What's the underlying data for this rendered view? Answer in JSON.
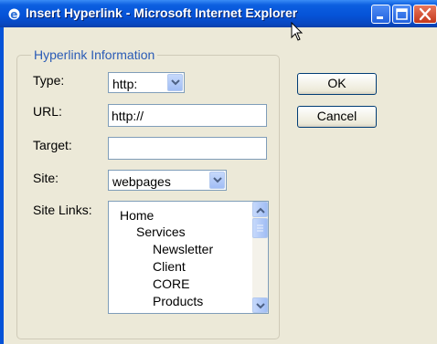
{
  "window": {
    "title": "Insert Hyperlink - Microsoft Internet Explorer",
    "icons": [
      "ie-icon",
      "minimize-icon",
      "maximize-icon",
      "close-icon"
    ]
  },
  "form": {
    "group_title": "Hyperlink Information",
    "type": {
      "label": "Type:",
      "value": "http:"
    },
    "url": {
      "label": "URL:",
      "value": "http://"
    },
    "target": {
      "label": "Target:",
      "value": ""
    },
    "site": {
      "label": "Site:",
      "value": "webpages"
    },
    "site_links": {
      "label": "Site Links:",
      "items": [
        "Home",
        "Services",
        "Newsletter",
        "Client",
        "CORE",
        "Products"
      ]
    }
  },
  "buttons": {
    "ok": "OK",
    "cancel": "Cancel"
  },
  "colors": {
    "titlebar": "#0553d8",
    "dialog_bg": "#ece9d8",
    "legend": "#2a5bb6",
    "input_border": "#7f9db9"
  }
}
